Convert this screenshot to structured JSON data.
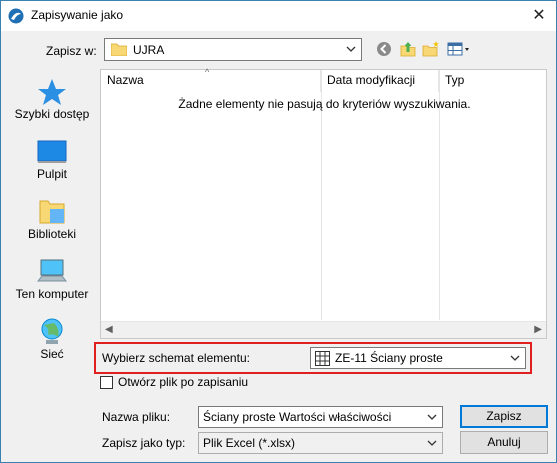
{
  "window": {
    "title": "Zapisywanie jako",
    "close_glyph": "✕"
  },
  "savein": {
    "label": "Zapisz w:",
    "value": "UJRA"
  },
  "toolbar": {
    "icons": [
      "back-icon",
      "up-folder-icon",
      "new-folder-icon",
      "view-menu-icon"
    ]
  },
  "places": [
    {
      "label": "Szybki dostęp",
      "icon": "star-icon"
    },
    {
      "label": "Pulpit",
      "icon": "desktop-icon"
    },
    {
      "label": "Biblioteki",
      "icon": "libraries-icon"
    },
    {
      "label": "Ten komputer",
      "icon": "computer-icon"
    },
    {
      "label": "Sieć",
      "icon": "network-icon"
    }
  ],
  "filelist": {
    "columns": [
      "Nazwa",
      "Data modyfikacji",
      "Typ"
    ],
    "empty_message": "Żadne elementy nie pasują do kryteriów wyszukiwania."
  },
  "schema": {
    "label": "Wybierz schemat elementu:",
    "value": "ZE-11 Ściany proste"
  },
  "open_after": {
    "label": "Otwórz plik po zapisaniu",
    "checked": false
  },
  "filename": {
    "label": "Nazwa pliku:",
    "value": "Ściany proste Wartości właściwości"
  },
  "filetype": {
    "label": "Zapisz jako typ:",
    "value": "Plik Excel (*.xlsx)"
  },
  "buttons": {
    "save": "Zapisz",
    "cancel": "Anuluj"
  },
  "colors": {
    "accent": "#0078d7",
    "highlight_border": "#e02020",
    "window_border": "#3c7fb1"
  }
}
